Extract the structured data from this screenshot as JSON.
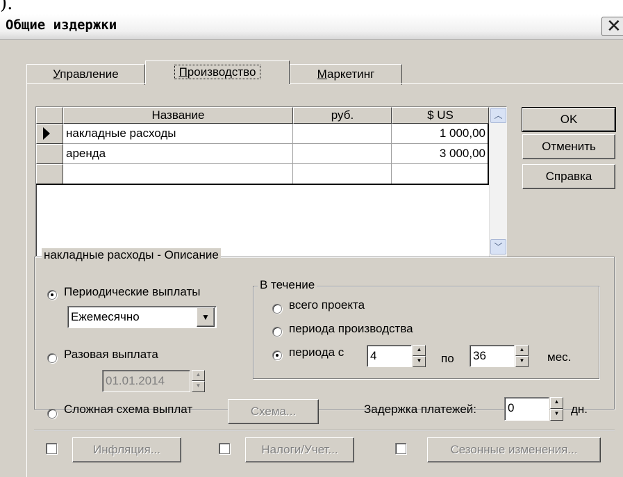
{
  "dialog": {
    "title": "Общие издержки"
  },
  "tabs": [
    {
      "mnemonic": "У",
      "rest": "правление"
    },
    {
      "mnemonic": "П",
      "rest": "роизводство"
    },
    {
      "mnemonic": "М",
      "rest": "аркетинг"
    }
  ],
  "grid": {
    "columns": [
      "Название",
      "руб.",
      "$ US"
    ],
    "rows": [
      {
        "name": "накладные расходы",
        "rub": "",
        "usd": "1 000,00"
      },
      {
        "name": "аренда",
        "rub": "",
        "usd": "3 000,00"
      },
      {
        "name": "",
        "rub": "",
        "usd": ""
      }
    ]
  },
  "buttons": {
    "ok": "OK",
    "cancel": "Отменить",
    "help": "Справка"
  },
  "description": {
    "legend": "накладные расходы - Описание",
    "periodic_label": "Периодические выплаты",
    "frequency_value": "Ежемесячно",
    "one_time_label": "Разовая выплата",
    "one_time_date": "01.01.2014",
    "complex_label": "Сложная схема выплат",
    "scheme_button": "Схема...",
    "during": {
      "legend": "В течение",
      "whole_project": "всего проекта",
      "production_period": "периода производства",
      "period_from": "периода с",
      "from_value": "4",
      "to_label": "по",
      "to_value": "36",
      "unit": "мес."
    },
    "delay_label": "Задержка платежей:",
    "delay_value": "0",
    "delay_unit": "дн."
  },
  "bottom": {
    "inflation": "Инфляция...",
    "taxes": "Налоги/Учет...",
    "seasonal": "Сезонные изменения..."
  }
}
